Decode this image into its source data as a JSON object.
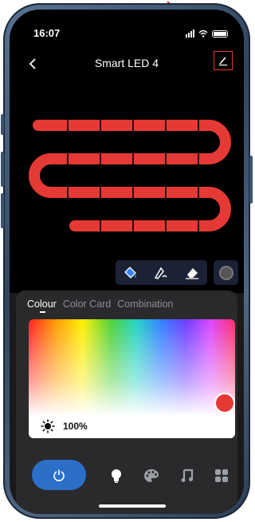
{
  "status_bar": {
    "time": "16:07"
  },
  "header": {
    "title": "Smart LED 4"
  },
  "tabs": [
    {
      "label": "Colour",
      "active": true
    },
    {
      "label": "Color Card",
      "active": false
    },
    {
      "label": "Combination",
      "active": false
    }
  ],
  "brightness": {
    "value": "100%",
    "level": 1.0
  },
  "colors": {
    "accent": "#2b6fc9",
    "led_color": "#e53935",
    "highlight": "#e53935"
  },
  "icons": {
    "paint_tool": "paint-bucket-icon",
    "draw_tool": "pen-icon",
    "erase_tool": "eraser-icon",
    "nav": [
      "power-icon",
      "bulb-icon",
      "palette-icon",
      "music-icon",
      "scenes-icon"
    ]
  }
}
